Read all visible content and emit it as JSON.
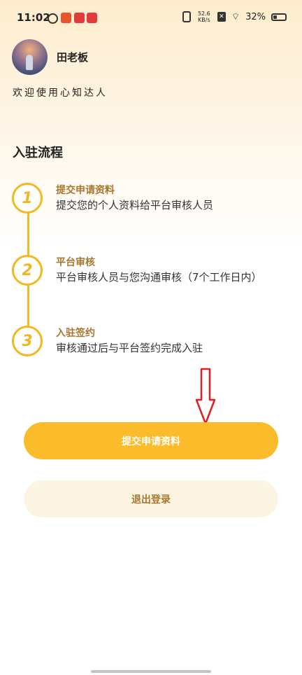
{
  "status_bar": {
    "time": "11:02",
    "net_speed_value": "52.6",
    "net_speed_unit": "KB/s",
    "battery": "32%",
    "battery_level": 0.32
  },
  "profile": {
    "name": "田老板",
    "welcome": "欢迎使用心知达人"
  },
  "section": {
    "title": "入驻流程"
  },
  "steps": [
    {
      "number": "1",
      "title": "提交申请资料",
      "desc": "提交您的个人资料给平台审核人员"
    },
    {
      "number": "2",
      "title": "平台审核",
      "desc": "平台审核人员与您沟通审核（7个工作日内）"
    },
    {
      "number": "3",
      "title": "入驻签约",
      "desc": "审核通过后与平台签约完成入驻"
    }
  ],
  "buttons": {
    "submit": "提交申请资料",
    "logout": "退出登录"
  },
  "colors": {
    "accent": "#fbbb2a",
    "step_title": "#a8772e",
    "annotation_arrow": "#e02020"
  }
}
